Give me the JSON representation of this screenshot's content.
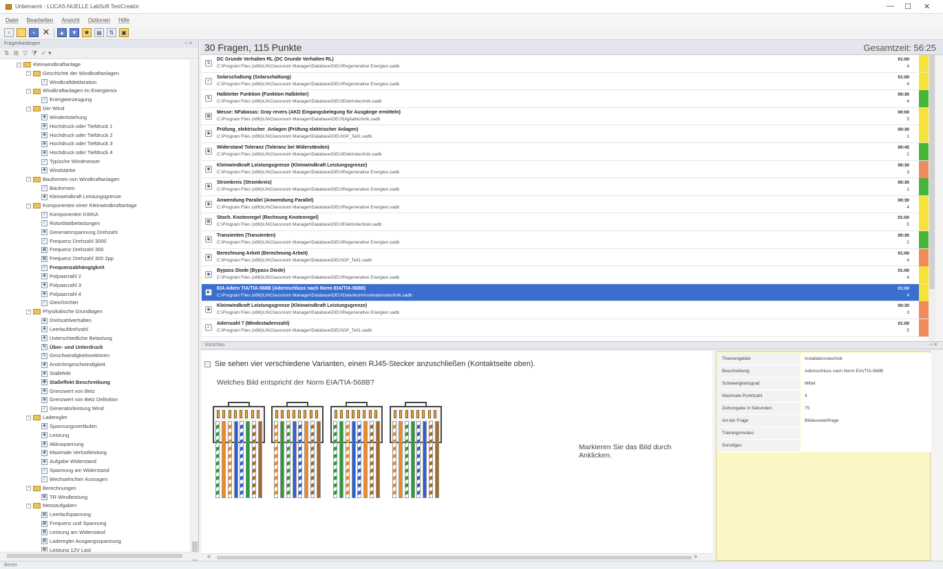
{
  "window": {
    "title": "Unbenannt - LUCAS-NUELLE LabSoft TestCreator",
    "minimize": "—",
    "maximize": "☐",
    "close": "✕"
  },
  "menu": [
    "Datei",
    "Bearbeiten",
    "Ansicht",
    "Optionen",
    "Hilfe"
  ],
  "left_panel": {
    "title": "Fragenkatalogen",
    "pin": "⊣ ✕",
    "tree": [
      {
        "label": "Kleinwindkraftanlage",
        "level": 1,
        "type": "folder"
      },
      {
        "label": "Geschichte der Windkraftanlagen",
        "level": 2,
        "type": "folder"
      },
      {
        "label": "Windkraftdeklaration",
        "level": 3,
        "type": "check"
      },
      {
        "label": "Windkraftanlagen im Energiemix",
        "level": 2,
        "type": "folder"
      },
      {
        "label": "Energieerzeugung",
        "level": 3,
        "type": "check"
      },
      {
        "label": "Der Wind",
        "level": 2,
        "type": "folder"
      },
      {
        "label": "Windentstehung",
        "level": 3,
        "type": "radio"
      },
      {
        "label": "Hochdruck oder Tiefdruck 1",
        "level": 3,
        "type": "radio"
      },
      {
        "label": "Hochdruck oder Tiefdruck 2",
        "level": 3,
        "type": "radio"
      },
      {
        "label": "Hochdruck oder Tiefdruck 3",
        "level": 3,
        "type": "radio"
      },
      {
        "label": "Hochdruck oder Tiefdruck 4",
        "level": 3,
        "type": "radio"
      },
      {
        "label": "Typische Windmesser",
        "level": 3,
        "type": "check"
      },
      {
        "label": "Windstärke",
        "level": 3,
        "type": "radio"
      },
      {
        "label": "Bauformen von Windkraftanlagen",
        "level": 2,
        "type": "folder"
      },
      {
        "label": "Bauformen",
        "level": 3,
        "type": "check"
      },
      {
        "label": "Kleinwindkraft Leistungsgrenze",
        "level": 3,
        "type": "radio"
      },
      {
        "label": "Komponenten einer Kleinwindkraftanlage",
        "level": 2,
        "type": "folder"
      },
      {
        "label": "Komponenten KWKA",
        "level": 3,
        "type": "check"
      },
      {
        "label": "Rotorblattbelastungen",
        "level": 3,
        "type": "check"
      },
      {
        "label": "Generatorspannung Drehzahl",
        "level": 3,
        "type": "radio"
      },
      {
        "label": "Frequenz Drehzahl 3000",
        "level": 3,
        "type": "check"
      },
      {
        "label": "Frequenz Drehzahl 300",
        "level": 3,
        "type": "grid"
      },
      {
        "label": "Frequenz Drehzahl 300 2pp",
        "level": 3,
        "type": "grid"
      },
      {
        "label": "Frequenzabhängigkeit",
        "level": 3,
        "type": "check",
        "bold": true
      },
      {
        "label": "Polpaarzahl 2",
        "level": 3,
        "type": "radio"
      },
      {
        "label": "Polpaarzahl 3",
        "level": 3,
        "type": "radio"
      },
      {
        "label": "Polpaarzahl 4",
        "level": 3,
        "type": "radio"
      },
      {
        "label": "Gleichrichter",
        "level": 3,
        "type": "check"
      },
      {
        "label": "Physikalische Grundlagen",
        "level": 2,
        "type": "folder"
      },
      {
        "label": "Drehzahlverhalten",
        "level": 3,
        "type": "radio"
      },
      {
        "label": "Leerlaufdrehzahl",
        "level": 3,
        "type": "radio"
      },
      {
        "label": "Unterschiedliche Belastung",
        "level": 3,
        "type": "radio"
      },
      {
        "label": "Über- und Unterdruck",
        "level": 3,
        "type": "sort",
        "bold": true
      },
      {
        "label": "Geschwindigkeitsvektoren",
        "level": 3,
        "type": "sort"
      },
      {
        "label": "Anströmgeschwindigkeit",
        "level": 3,
        "type": "radio"
      },
      {
        "label": "Stallefekt",
        "level": 3,
        "type": "radio"
      },
      {
        "label": "Stalleffekt Beschreibung",
        "level": 3,
        "type": "radio",
        "bold": true
      },
      {
        "label": "Grenzwert von Betz",
        "level": 3,
        "type": "radio"
      },
      {
        "label": "Grenzwert von Betz Definition",
        "level": 3,
        "type": "radio"
      },
      {
        "label": "Generatorleistung Wind",
        "level": 3,
        "type": "check"
      },
      {
        "label": "Laderegler",
        "level": 2,
        "type": "folder"
      },
      {
        "label": "Spannungsverläufen",
        "level": 3,
        "type": "radio"
      },
      {
        "label": "Leistung",
        "level": 3,
        "type": "radio"
      },
      {
        "label": "Akkuspannung",
        "level": 3,
        "type": "radio"
      },
      {
        "label": "Maximale Verlustleistung",
        "level": 3,
        "type": "radio"
      },
      {
        "label": "Aufgabe Widerstand",
        "level": 3,
        "type": "radio"
      },
      {
        "label": "Spannung am Widerstand",
        "level": 3,
        "type": "check"
      },
      {
        "label": "Wechselrichter Aussagen",
        "level": 3,
        "type": "check"
      },
      {
        "label": "Berechnungen",
        "level": 2,
        "type": "folder"
      },
      {
        "label": "TR Windleistung",
        "level": 3,
        "type": "grid"
      },
      {
        "label": "Messaufgaben",
        "level": 2,
        "type": "folder"
      },
      {
        "label": "Leerlaufspannung",
        "level": 3,
        "type": "grid"
      },
      {
        "label": "Frequenz und Spannung",
        "level": 3,
        "type": "grid"
      },
      {
        "label": "Leistung am Widerstand",
        "level": 3,
        "type": "grid"
      },
      {
        "label": "Laderegler Ausgangsspannung",
        "level": 3,
        "type": "grid"
      },
      {
        "label": "Leistung 12V Last",
        "level": 3,
        "type": "grid"
      }
    ]
  },
  "list": {
    "summary": "30 Fragen, 115 Punkte",
    "total_time": "Gesamtzeit: 56:25",
    "items": [
      {
        "icon": "sort",
        "title": "DC Grunde Verhalten RL (DC Grunde Verhalten RL)",
        "path": "C:\\Program Files (x86)\\LN\\Classroom Manager\\Database\\DEU\\Regenerative Energien.sadb",
        "time": "01:00",
        "points": "4",
        "status": "#f5e23a"
      },
      {
        "icon": "check",
        "title": "Solarschaltung (Solarschaltung)",
        "path": "C:\\Program Files (x86)\\LN\\Classroom Manager\\Database\\DEU\\Regenerative Energien.sadb",
        "time": "01:00",
        "points": "4",
        "status": "#f5e23a"
      },
      {
        "icon": "sort",
        "title": "Halbleiter Funktion (Funktion Halbleiter)",
        "path": "C:\\Program Files (x86)\\LN\\Classroom Manager\\Database\\DEU\\Elektrotechnik.sadb",
        "time": "00:30",
        "points": "4",
        "status": "#47b53a"
      },
      {
        "icon": "grid",
        "title": "Messe: NFabocas: Gray revers (AKD Eingangsbelegung für Ausgänge ermitteln)",
        "path": "C:\\Program Files (x86)\\LN\\Classroom Manager\\Database\\DEU\\Digitaltechnik.sadb",
        "time": "00:00",
        "points": "5",
        "status": "#f5e23a"
      },
      {
        "icon": "radio",
        "title": "Prüfung_elektrischer_Anlagen (Prüfung elektrischer Anlagen)",
        "path": "C:\\Program Files (x86)\\LN\\Classroom Manager\\Database\\DEU\\GP_Teil1.sadb",
        "time": "00:30",
        "points": "1",
        "status": "#f5e23a"
      },
      {
        "icon": "radio",
        "title": "Widerstand Toleranz (Toleranz bei Widerständen)",
        "path": "C:\\Program Files (x86)\\LN\\Classroom Manager\\Database\\DEU\\Elektrotechnik.sadb",
        "time": "00:45",
        "points": "2",
        "status": "#47b53a"
      },
      {
        "icon": "radio",
        "title": "Kleinwindkraft Leistungsgrenze (Kleinwindkraft Leistungsgrenze)",
        "path": "C:\\Program Files (x86)\\LN\\Classroom Manager\\Database\\DEU\\Regenerative Energien.sadb",
        "time": "00:30",
        "points": "3",
        "status": "#ef8a5c"
      },
      {
        "icon": "radio",
        "title": "Stromkreis (Stromkreis)",
        "path": "C:\\Program Files (x86)\\LN\\Classroom Manager\\Database\\DEU\\Regenerative Energien.sadb",
        "time": "00:30",
        "points": "1",
        "status": "#47b53a"
      },
      {
        "icon": "radio",
        "title": "Anwendung Parallel (Anwendung Parallel)",
        "path": "C:\\Program Files (x86)\\LN\\Classroom Manager\\Database\\DEU\\Regenerative Energien.sadb",
        "time": "00:30",
        "points": "4",
        "status": "#f5e23a"
      },
      {
        "icon": "grid",
        "title": "Stoch. Knotenregel (Rechnung Knotenregel)",
        "path": "C:\\Program Files (x86)\\LN\\Classroom Manager\\Database\\DEU\\Elektrotechnik.sadb",
        "time": "01:00",
        "points": "5",
        "status": "#f5e23a"
      },
      {
        "icon": "radio",
        "title": "Transienten (Transienten)",
        "path": "C:\\Program Files (x86)\\LN\\Classroom Manager\\Database\\DEU\\Regenerative Energien.sadb",
        "time": "00:30",
        "points": "2",
        "status": "#47b53a"
      },
      {
        "icon": "radio",
        "title": "Berechnung Arbeit (Berechnung Arbeit)",
        "path": "C:\\Program Files (x86)\\LN\\Classroom Manager\\Database\\DEU\\GP_Teil1.sadb",
        "time": "01:00",
        "points": "4",
        "status": "#ef8a5c"
      },
      {
        "icon": "radio",
        "title": "Bypass Diode (Bypass Diode)",
        "path": "C:\\Program Files (x86)\\LN\\Classroom Manager\\Database\\DEU\\Regenerative Energien.sadb",
        "time": "01:00",
        "points": "4",
        "status": "#f5e23a"
      },
      {
        "icon": "image",
        "title": "EIA Adern TIA/TIA-568B (Adernschluss nach Norm EIA/TIA-568B)",
        "path": "C:\\Program Files (x86)\\LN\\Classroom Manager\\Database\\DEU\\Datenkommunikationstechnik.sadb",
        "time": "01:00",
        "points": "4",
        "status": "#f5e23a",
        "selected": true
      },
      {
        "icon": "radio",
        "title": "Kleinwindkraft Leistungsgrenze (Kleinwindkraft Leistungsgrenze)",
        "path": "C:\\Program Files (x86)\\LN\\Classroom Manager\\Database\\DEU\\Regenerative Energien.sadb",
        "time": "00:30",
        "points": "3",
        "status": "#ef8a5c"
      },
      {
        "icon": "check",
        "title": "Adernzahl 7 (Mindestadernzahl)",
        "path": "C:\\Program Files (x86)\\LN\\Classroom Manager\\Database\\DEU\\GP_Teil1.sadb",
        "time": "01:00",
        "points": "5",
        "status": "#ef8a5c"
      }
    ]
  },
  "preview_panel": {
    "title": "Vorschau",
    "question": "Sie sehen vier verschiedene Varianten, einen RJ45-Stecker anzuschließen (Kontaktseite oben).",
    "subquestion": "Welches Bild entspricht der Norm EIA/TIA-568B?",
    "hint_line1": "Markieren Sie das Bild durch",
    "hint_line2": "Anklicken.",
    "scroll_left": "<",
    "scroll_right": ">",
    "plugs": [
      {
        "wires": [
          "#ffffff",
          "#f08a22",
          "#ffffff",
          "#2f5fd0",
          "#ffffff",
          "#2a9c3a",
          "#ffffff",
          "#a56a2a"
        ],
        "stripes": [
          "#2a9c3a",
          "",
          "#f08a22",
          "",
          "#2f5fd0",
          "",
          "#a56a2a",
          ""
        ]
      },
      {
        "wires": [
          "#ffffff",
          "#2a9c3a",
          "#ffffff",
          "#2f5fd0",
          "#ffffff",
          "#f08a22",
          "#ffffff",
          "#a56a2a"
        ],
        "stripes": [
          "#f08a22",
          "",
          "#2a9c3a",
          "",
          "#2f5fd0",
          "",
          "#a56a2a",
          ""
        ]
      },
      {
        "wires": [
          "#ffffff",
          "#2a9c3a",
          "#ffffff",
          "#2f5fd0",
          "#ffffff",
          "#f08a22",
          "#ffffff",
          "#a56a2a"
        ],
        "stripes": [
          "#2a9c3a",
          "",
          "#f08a22",
          "",
          "#2f5fd0",
          "",
          "#a56a2a",
          ""
        ]
      },
      {
        "wires": [
          "#ffffff",
          "#f08a22",
          "#ffffff",
          "#2a9c3a",
          "#ffffff",
          "#2f5fd0",
          "#ffffff",
          "#a56a2a"
        ],
        "stripes": [
          "#f08a22",
          "",
          "#2a9c3a",
          "",
          "#2f5fd0",
          "",
          "#a56a2a",
          ""
        ]
      }
    ]
  },
  "properties": [
    {
      "key": "Themengebiet",
      "value": "Installationstechnik"
    },
    {
      "key": "Beschreibung",
      "value": "Adernschluss nach Norm EIA/TIA-568B"
    },
    {
      "key": "Schwierigkeitsgrad",
      "value": "Mittel"
    },
    {
      "key": "Maximale Punktzahl",
      "value": "4"
    },
    {
      "key": "Zeitvorgabe in Sekunden",
      "value": "75"
    },
    {
      "key": "Art der Frage",
      "value": "Bildauswahlfrage"
    },
    {
      "key": "Trainingsmodus",
      "value": ""
    },
    {
      "key": "Sonstiges",
      "value": ""
    }
  ],
  "status": {
    "text": "Bereit"
  }
}
